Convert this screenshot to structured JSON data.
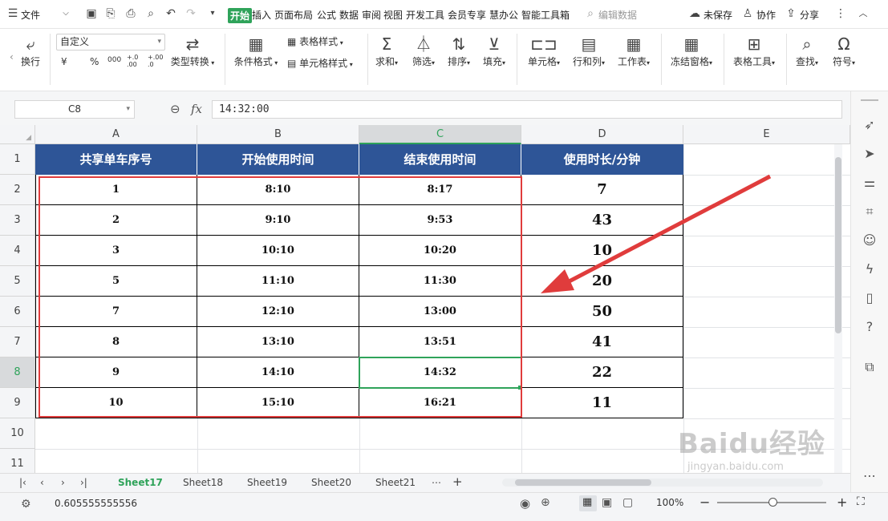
{
  "menubar": {
    "file_label": "文件",
    "tabs": [
      "开始",
      "插入",
      "页面布局",
      "公式",
      "数据",
      "审阅",
      "视图",
      "开发工具",
      "会员专享",
      "慧办公",
      "智能工具箱"
    ],
    "search_placeholder": "编辑数据",
    "unsaved_label": "未保存",
    "collab_label": "协作",
    "share_label": "分享"
  },
  "ribbon": {
    "wrap_label": "换行",
    "number_format": "自定义",
    "type_convert_label": "类型转换",
    "cond_format_label": "条件格式",
    "table_style_label": "表格样式",
    "cell_style_label": "单元格样式",
    "sum_label": "求和",
    "filter_label": "筛选",
    "sort_label": "排序",
    "fill_label": "填充",
    "cell_label": "单元格",
    "rowcol_label": "行和列",
    "worksheet_label": "工作表",
    "freeze_label": "冻结窗格",
    "table_tools_label": "表格工具",
    "find_label": "查找",
    "symbol_label": "符号",
    "currency_symbol": "¥",
    "percent_symbol": "%",
    "thousands_symbol": "000",
    "dec_inc_symbol": "+.0 .00",
    "dec_dec_symbol": "+.00 .0"
  },
  "formula_bar": {
    "cell_ref": "C8",
    "fx_label": "fx",
    "formula_value": "14:32:00"
  },
  "columns": [
    "A",
    "B",
    "C",
    "D",
    "E"
  ],
  "rows": [
    "1",
    "2",
    "3",
    "4",
    "5",
    "6",
    "7",
    "8",
    "9",
    "10",
    "11"
  ],
  "table": {
    "headers": [
      "共享单车序号",
      "开始使用时间",
      "结束使用时间",
      "使用时长/分钟"
    ],
    "data": [
      [
        "1",
        "8:10",
        "8:17",
        "7"
      ],
      [
        "2",
        "9:10",
        "9:53",
        "43"
      ],
      [
        "3",
        "10:10",
        "10:20",
        "10"
      ],
      [
        "5",
        "11:10",
        "11:30",
        "20"
      ],
      [
        "7",
        "12:10",
        "13:00",
        "50"
      ],
      [
        "8",
        "13:10",
        "13:51",
        "41"
      ],
      [
        "9",
        "14:10",
        "14:32",
        "22"
      ],
      [
        "10",
        "15:10",
        "16:21",
        "11"
      ]
    ]
  },
  "sheet_tabs": [
    "Sheet17",
    "Sheet18",
    "Sheet19",
    "Sheet20",
    "Sheet21"
  ],
  "status": {
    "value": "0.605555555556",
    "zoom": "100%"
  },
  "watermark": {
    "brand": "Baidu经验",
    "url": "jingyan.baidu.com"
  },
  "colors": {
    "header_fill": "#2e5597",
    "accent_green": "#2fa35a",
    "highlight_red": "#e03c3c"
  }
}
